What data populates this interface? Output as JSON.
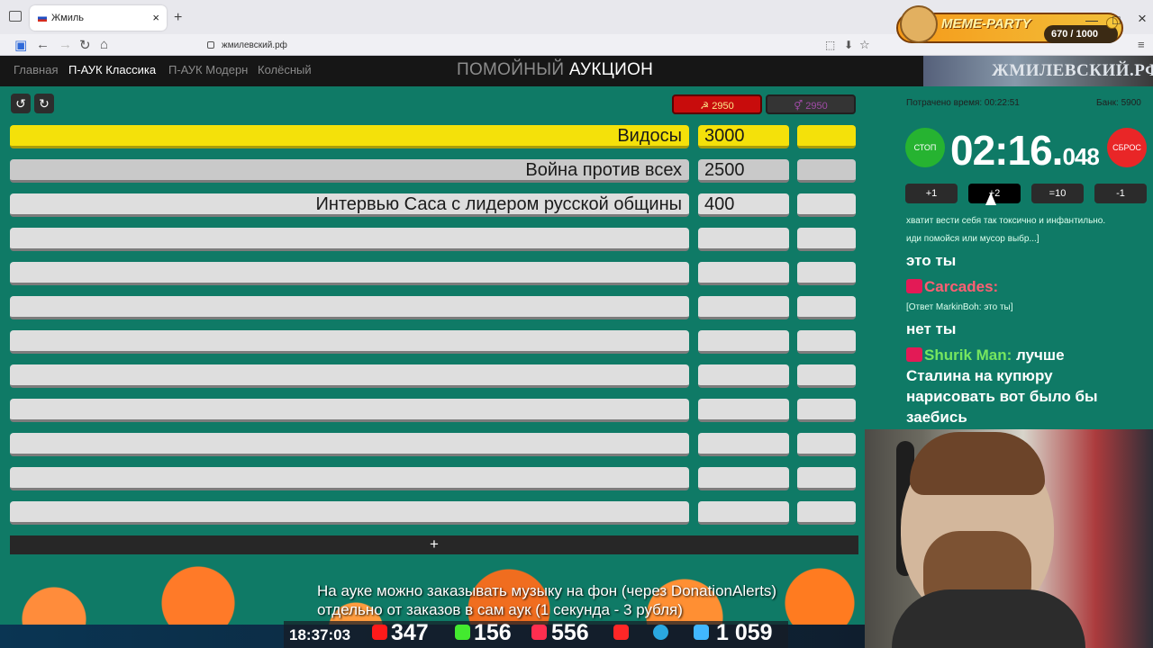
{
  "browser": {
    "tab_title": "Жмиль",
    "url": "жмилевский.рф",
    "new_tab": "+",
    "close": "×"
  },
  "meme_party": {
    "title": "MEME-PARTY",
    "count": "670 / 1000"
  },
  "header": {
    "menu": [
      "Главная",
      "П-АУК Классика",
      "П-АУК Модерн",
      "Колёсный"
    ],
    "brand_gray": "ПОМОЙНЫЙ",
    "brand_white": "АУКЦИОН",
    "banner": "ЖМИЛЕВСКИЙ.РФ"
  },
  "toolbar": {
    "undo": "↺",
    "redo": "↻",
    "red_total": "☭ 2950",
    "gender_total": "⚥ 2950"
  },
  "lots": [
    {
      "name": "Видосы",
      "amount": "3000",
      "extra": ""
    },
    {
      "name": "Война против всех",
      "amount": "2500",
      "extra": ""
    },
    {
      "name": "Интервью Саса с лидером русской общины",
      "amount": "400",
      "extra": ""
    },
    {
      "name": "",
      "amount": "",
      "extra": ""
    },
    {
      "name": "",
      "amount": "",
      "extra": ""
    },
    {
      "name": "",
      "amount": "",
      "extra": ""
    },
    {
      "name": "",
      "amount": "",
      "extra": ""
    },
    {
      "name": "",
      "amount": "",
      "extra": ""
    },
    {
      "name": "",
      "amount": "",
      "extra": ""
    },
    {
      "name": "",
      "amount": "",
      "extra": ""
    },
    {
      "name": "",
      "amount": "",
      "extra": ""
    },
    {
      "name": "",
      "amount": "",
      "extra": ""
    }
  ],
  "add_lot": "+",
  "stats": {
    "spent_time": "Потрачено время: 00:22:51",
    "bank": "Банк: 5900",
    "stop": "СТОП",
    "reset": "СБРОС",
    "timer_main": "02:16.",
    "timer_ms": "048",
    "steps": [
      "+1",
      "+2",
      "=10",
      "-1"
    ]
  },
  "chat": {
    "line1": "хватит вести себя так токсично и инфантильно.",
    "line2": "иди помойся или мусор выбр...]",
    "msg1": "это ты",
    "user1": "Carcades:",
    "reply1": "[Ответ MarkinBoh: это ты]",
    "msg2": "нет ты",
    "user2": "Shurik Man:",
    "msg3": "лучше",
    "msg4": "Сталина на купюру",
    "msg5": "нарисовать вот было бы",
    "msg6": "заебись"
  },
  "overlay": {
    "clock": "18:37:03",
    "youtube_count": "347",
    "kick_count": "156",
    "live_count": "556",
    "vk_count": "1 059",
    "caption_line1": "На ауке можно заказывать музыку на фон (через DonationAlerts)",
    "caption_line2": "отдельно от заказов в сам аук (1 секунда - 3 рубля)"
  }
}
